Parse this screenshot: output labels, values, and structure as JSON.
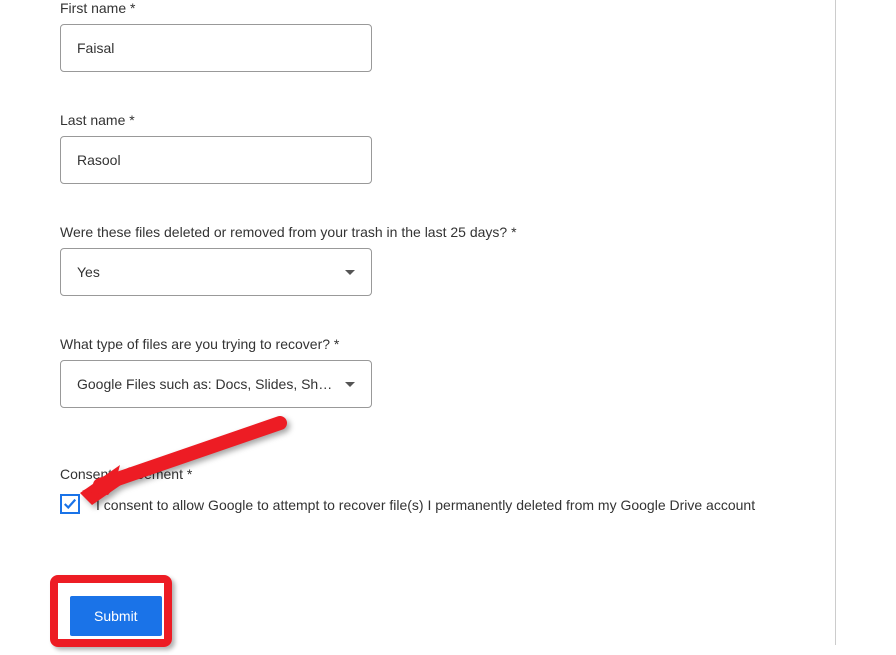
{
  "fields": {
    "firstName": {
      "label": "First name *",
      "value": "Faisal"
    },
    "lastName": {
      "label": "Last name *",
      "value": "Rasool"
    },
    "deletedInLast25": {
      "label": "Were these files deleted or removed from your trash in the last 25 days? *",
      "value": "Yes"
    },
    "fileType": {
      "label": "What type of files are you trying to recover? *",
      "value": "Google Files such as: Docs, Slides, She..."
    }
  },
  "consent": {
    "label": "Consent agreement *",
    "text": "I consent to allow Google to attempt to recover file(s) I permanently deleted from my Google Drive account",
    "checked": true
  },
  "submit": {
    "label": "Submit"
  },
  "colors": {
    "primary": "#1a73e8",
    "annotation": "#ed1c24"
  }
}
